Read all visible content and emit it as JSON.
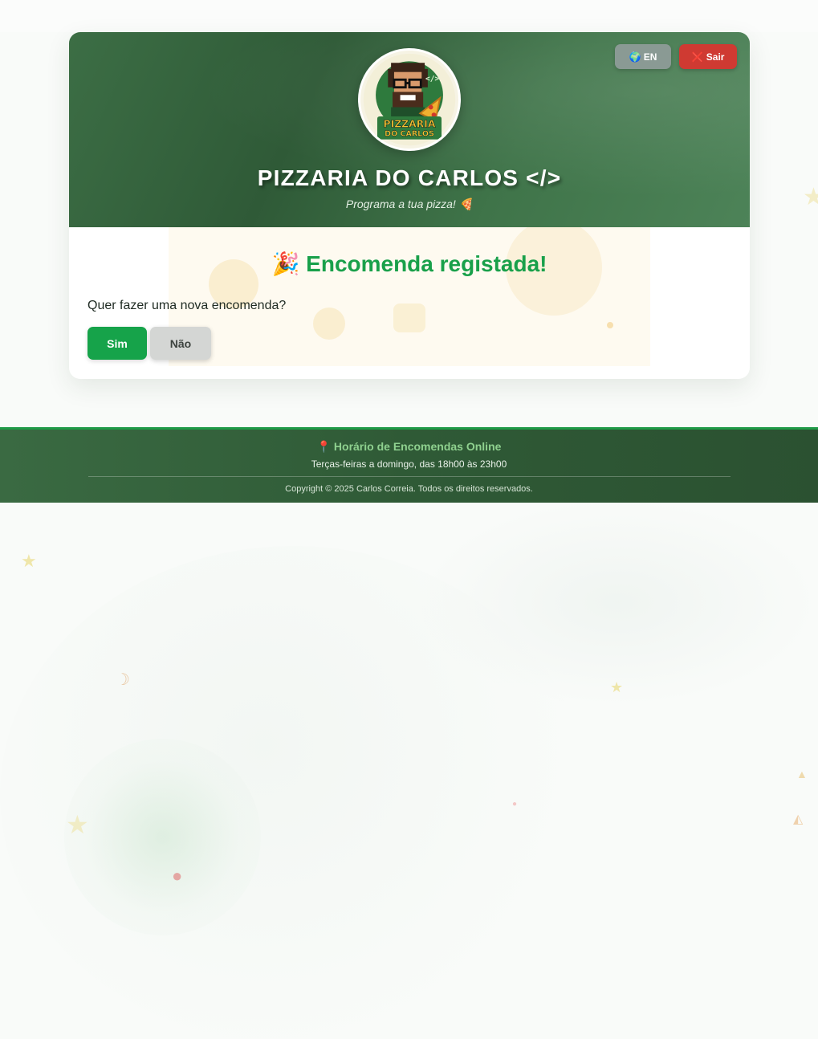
{
  "header": {
    "brand": "PIZZARIA DO CARLOS </>",
    "tagline": "Programa a tua pizza! 🍕",
    "logo_text_line1": "PIZZARIA",
    "logo_text_line2": "DO CARLOS",
    "logo_code": "</>",
    "lang_button": "🌍 EN",
    "exit_button": "❌ Sair"
  },
  "main": {
    "success_message": "🎉 Encomenda registada!",
    "question": "Quer fazer uma nova encomenda?",
    "yes_label": "Sim",
    "no_label": "Não"
  },
  "footer": {
    "title": "📍 Horário de Encomendas Online",
    "hours": "Terças-feiras a domingo, das 18h00 às 23h00",
    "copyright": "Copyright © 2025 Carlos Correia. Todos os direitos reservados."
  },
  "colors": {
    "brand_green": "#2f5a37",
    "success_green": "#19a04a",
    "yes_button": "#16a34a",
    "exit_red": "#cf3a32",
    "lang_grey": "#8a9a94"
  },
  "decorations": [
    "star-icon",
    "pepper-icon",
    "tomato-icon",
    "pizza-slice-icon",
    "cheese-icon"
  ]
}
